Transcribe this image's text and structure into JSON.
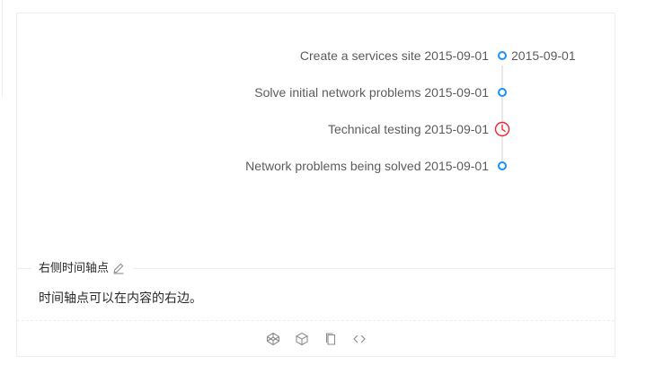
{
  "timeline": {
    "items": [
      {
        "content": "Create a services site 2015-09-01",
        "label": "2015-09-01",
        "dot": "circle",
        "color": "#1890ff"
      },
      {
        "content": "Solve initial network problems 2015-09-01",
        "label": "",
        "dot": "circle",
        "color": "#1890ff"
      },
      {
        "content": "Technical testing 2015-09-01",
        "label": "",
        "dot": "clock-icon",
        "color": "#f5222d"
      },
      {
        "content": "Network problems being solved 2015-09-01",
        "label": "",
        "dot": "circle",
        "color": "#1890ff"
      }
    ]
  },
  "meta": {
    "title": "右侧时间轴点",
    "description": "时间轴点可以在内容的右边。"
  },
  "actions": [
    {
      "name": "codepen-icon"
    },
    {
      "name": "codesandbox-icon"
    },
    {
      "name": "copy-icon"
    },
    {
      "name": "expand-code-icon"
    }
  ]
}
